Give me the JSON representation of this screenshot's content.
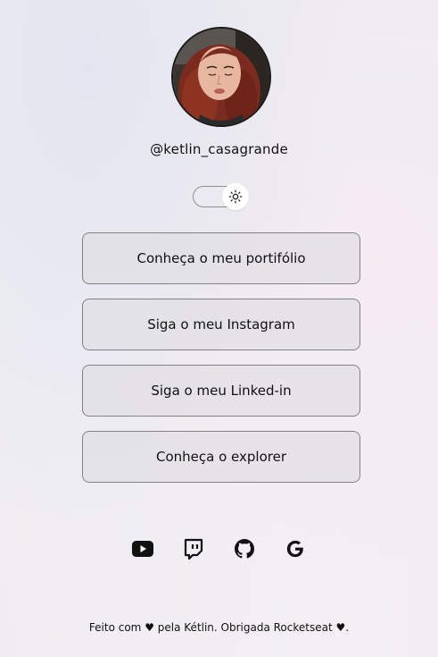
{
  "profile": {
    "username": "@ketlin_casagrande"
  },
  "theme_switch": {
    "icon": "sun-icon"
  },
  "links": [
    {
      "label": "Conheça o meu portifólio"
    },
    {
      "label": "Siga o meu Instagram"
    },
    {
      "label": "Siga o meu Linked-in"
    },
    {
      "label": "Conheça o explorer"
    }
  ],
  "socials": [
    {
      "icon": "youtube-icon"
    },
    {
      "icon": "twitch-icon"
    },
    {
      "icon": "github-icon"
    },
    {
      "icon": "google-icon"
    }
  ],
  "footer": {
    "part1": "Feito com",
    "heart": "♥",
    "part2": "pela Kétlin. Obrigada Rocketseat",
    "heart2": "♥",
    "end": "."
  }
}
